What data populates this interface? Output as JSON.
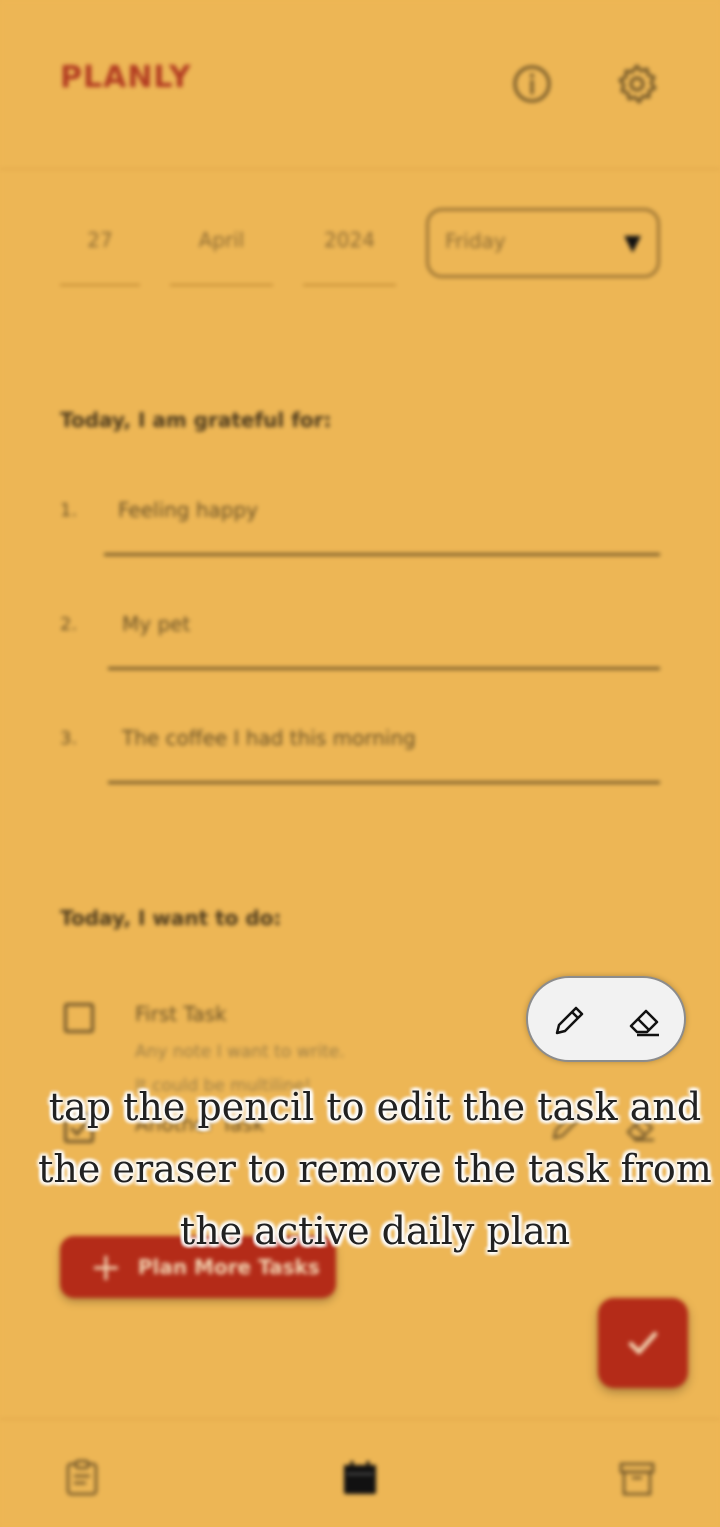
{
  "header": {
    "app_title": "PLANLY",
    "info_icon": "info-icon",
    "settings_icon": "gear-icon"
  },
  "date": {
    "day": "27",
    "month": "April",
    "year": "2024",
    "weekday": "Friday"
  },
  "gratitude": {
    "title": "Today, I am grateful for:",
    "items": [
      {
        "number": "1.",
        "value": "Feeling happy"
      },
      {
        "number": "2.",
        "value": "My pet"
      },
      {
        "number": "3.",
        "value": "The coffee I had this morning"
      }
    ]
  },
  "tasks": {
    "title": "Today, I want to do:",
    "items": [
      {
        "title": "First Task",
        "note_line1": "Any note I want to write.",
        "note_line2": "It could be multiline!",
        "checked": false
      },
      {
        "title": "Another Task",
        "checked": true
      }
    ],
    "plan_more_label": "Plan More Tasks"
  },
  "overlay": {
    "hint": "tap the pencil to edit the task and the eraser to remove the task from the active daily plan",
    "icons": [
      "pencil-icon",
      "eraser-icon"
    ]
  },
  "bottom_nav": {
    "icons": [
      "clipboard-icon",
      "calendar-icon",
      "archive-icon"
    ]
  },
  "colors": {
    "background": "#edb655",
    "accent": "#b42b18",
    "title": "#b33d22"
  }
}
